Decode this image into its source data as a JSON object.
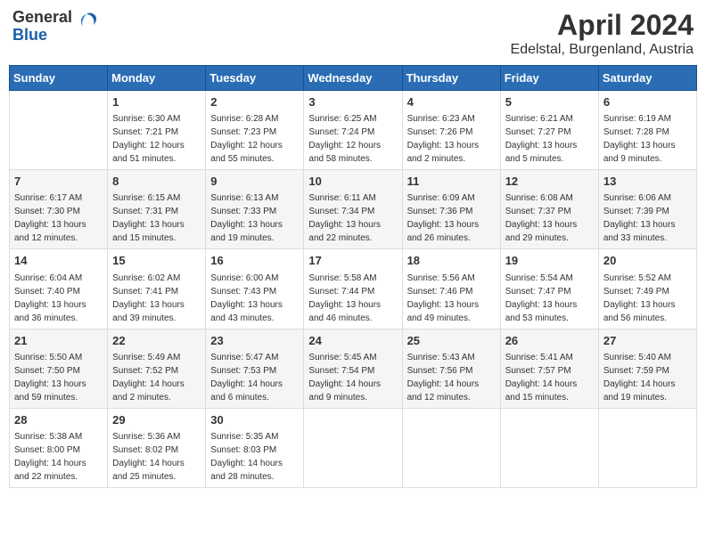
{
  "header": {
    "logo_general": "General",
    "logo_blue": "Blue",
    "title": "April 2024",
    "location": "Edelstal, Burgenland, Austria"
  },
  "days_of_week": [
    "Sunday",
    "Monday",
    "Tuesday",
    "Wednesday",
    "Thursday",
    "Friday",
    "Saturday"
  ],
  "weeks": [
    [
      null,
      {
        "day": 1,
        "sunrise": "6:30 AM",
        "sunset": "7:21 PM",
        "daylight": "12 hours and 51 minutes."
      },
      {
        "day": 2,
        "sunrise": "6:28 AM",
        "sunset": "7:23 PM",
        "daylight": "12 hours and 55 minutes."
      },
      {
        "day": 3,
        "sunrise": "6:25 AM",
        "sunset": "7:24 PM",
        "daylight": "12 hours and 58 minutes."
      },
      {
        "day": 4,
        "sunrise": "6:23 AM",
        "sunset": "7:26 PM",
        "daylight": "13 hours and 2 minutes."
      },
      {
        "day": 5,
        "sunrise": "6:21 AM",
        "sunset": "7:27 PM",
        "daylight": "13 hours and 5 minutes."
      },
      {
        "day": 6,
        "sunrise": "6:19 AM",
        "sunset": "7:28 PM",
        "daylight": "13 hours and 9 minutes."
      }
    ],
    [
      {
        "day": 7,
        "sunrise": "6:17 AM",
        "sunset": "7:30 PM",
        "daylight": "13 hours and 12 minutes."
      },
      {
        "day": 8,
        "sunrise": "6:15 AM",
        "sunset": "7:31 PM",
        "daylight": "13 hours and 15 minutes."
      },
      {
        "day": 9,
        "sunrise": "6:13 AM",
        "sunset": "7:33 PM",
        "daylight": "13 hours and 19 minutes."
      },
      {
        "day": 10,
        "sunrise": "6:11 AM",
        "sunset": "7:34 PM",
        "daylight": "13 hours and 22 minutes."
      },
      {
        "day": 11,
        "sunrise": "6:09 AM",
        "sunset": "7:36 PM",
        "daylight": "13 hours and 26 minutes."
      },
      {
        "day": 12,
        "sunrise": "6:08 AM",
        "sunset": "7:37 PM",
        "daylight": "13 hours and 29 minutes."
      },
      {
        "day": 13,
        "sunrise": "6:06 AM",
        "sunset": "7:39 PM",
        "daylight": "13 hours and 33 minutes."
      }
    ],
    [
      {
        "day": 14,
        "sunrise": "6:04 AM",
        "sunset": "7:40 PM",
        "daylight": "13 hours and 36 minutes."
      },
      {
        "day": 15,
        "sunrise": "6:02 AM",
        "sunset": "7:41 PM",
        "daylight": "13 hours and 39 minutes."
      },
      {
        "day": 16,
        "sunrise": "6:00 AM",
        "sunset": "7:43 PM",
        "daylight": "13 hours and 43 minutes."
      },
      {
        "day": 17,
        "sunrise": "5:58 AM",
        "sunset": "7:44 PM",
        "daylight": "13 hours and 46 minutes."
      },
      {
        "day": 18,
        "sunrise": "5:56 AM",
        "sunset": "7:46 PM",
        "daylight": "13 hours and 49 minutes."
      },
      {
        "day": 19,
        "sunrise": "5:54 AM",
        "sunset": "7:47 PM",
        "daylight": "13 hours and 53 minutes."
      },
      {
        "day": 20,
        "sunrise": "5:52 AM",
        "sunset": "7:49 PM",
        "daylight": "13 hours and 56 minutes."
      }
    ],
    [
      {
        "day": 21,
        "sunrise": "5:50 AM",
        "sunset": "7:50 PM",
        "daylight": "13 hours and 59 minutes."
      },
      {
        "day": 22,
        "sunrise": "5:49 AM",
        "sunset": "7:52 PM",
        "daylight": "14 hours and 2 minutes."
      },
      {
        "day": 23,
        "sunrise": "5:47 AM",
        "sunset": "7:53 PM",
        "daylight": "14 hours and 6 minutes."
      },
      {
        "day": 24,
        "sunrise": "5:45 AM",
        "sunset": "7:54 PM",
        "daylight": "14 hours and 9 minutes."
      },
      {
        "day": 25,
        "sunrise": "5:43 AM",
        "sunset": "7:56 PM",
        "daylight": "14 hours and 12 minutes."
      },
      {
        "day": 26,
        "sunrise": "5:41 AM",
        "sunset": "7:57 PM",
        "daylight": "14 hours and 15 minutes."
      },
      {
        "day": 27,
        "sunrise": "5:40 AM",
        "sunset": "7:59 PM",
        "daylight": "14 hours and 19 minutes."
      }
    ],
    [
      {
        "day": 28,
        "sunrise": "5:38 AM",
        "sunset": "8:00 PM",
        "daylight": "14 hours and 22 minutes."
      },
      {
        "day": 29,
        "sunrise": "5:36 AM",
        "sunset": "8:02 PM",
        "daylight": "14 hours and 25 minutes."
      },
      {
        "day": 30,
        "sunrise": "5:35 AM",
        "sunset": "8:03 PM",
        "daylight": "14 hours and 28 minutes."
      },
      null,
      null,
      null,
      null
    ]
  ]
}
